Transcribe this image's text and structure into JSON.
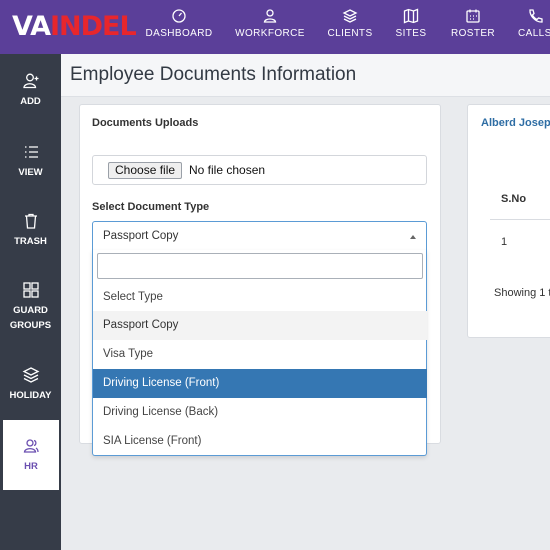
{
  "header": {
    "logo_prefix": "VA",
    "logo_suffix": "INDEL",
    "nav": [
      {
        "label": "DASHBOARD",
        "icon": "gauge-icon"
      },
      {
        "label": "WORKFORCE",
        "icon": "user-icon"
      },
      {
        "label": "CLIENTS",
        "icon": "layers-icon"
      },
      {
        "label": "SITES",
        "icon": "map-icon"
      },
      {
        "label": "ROSTER",
        "icon": "calendar-icon"
      },
      {
        "label": "CALLS",
        "icon": "phone-icon"
      }
    ]
  },
  "sidebar": {
    "items": [
      {
        "label": "ADD",
        "icon": "add-user-icon"
      },
      {
        "label": "VIEW",
        "icon": "list-icon"
      },
      {
        "label": "TRASH",
        "icon": "trash-icon"
      },
      {
        "label": "GUARD GROUPS",
        "icon": "grid-icon"
      },
      {
        "label": "HOLIDAY",
        "icon": "layers-icon"
      },
      {
        "label": "HR",
        "icon": "users-icon"
      }
    ]
  },
  "page": {
    "title": "Employee Documents Information"
  },
  "documents": {
    "heading": "Documents Uploads",
    "file_button": "Choose file",
    "file_status": "No file chosen",
    "type_label": "Select Document Type",
    "selected_value": "Passport Copy",
    "search_value": "",
    "options": [
      "Select Type",
      "Passport Copy",
      "Visa Type",
      "Driving License (Front)",
      "Driving License (Back)",
      "SIA License (Front)"
    ],
    "highlighted_option": "Driving License (Front)"
  },
  "right_panel": {
    "employee_name": "Alberd Josep",
    "col_sno": "S.No",
    "row_sno": "1",
    "showing": "Showing 1 t"
  },
  "colors": {
    "header_bg": "#5b3f99",
    "sidebar_bg": "#363c48",
    "accent_blue": "#3577b3",
    "logo_red": "#e8262c"
  }
}
